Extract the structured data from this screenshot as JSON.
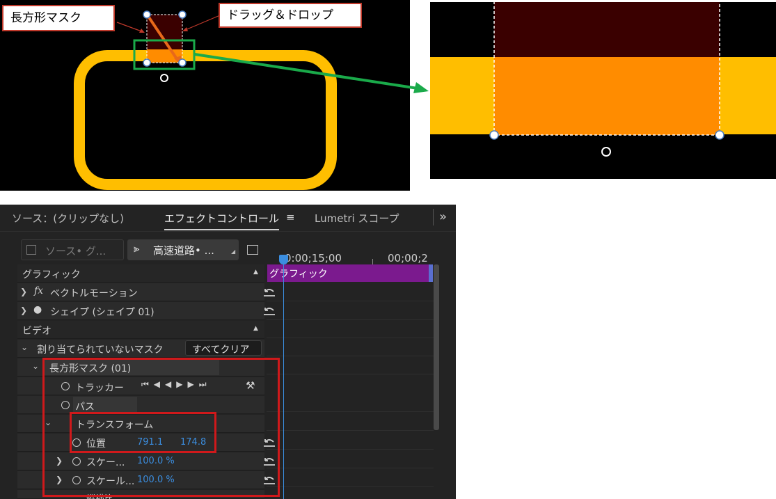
{
  "callouts": {
    "rect_mask": "長方形マスク",
    "drag_drop": "ドラッグ＆ドロップ"
  },
  "panel": {
    "tabs": {
      "source": "ソース：(クリップなし)",
      "effect_controls": "エフェクトコントロール",
      "lumetri": "Lumetri スコープ",
      "overflow": "»"
    },
    "source_dropdown": "ソース• グ...",
    "sequence_dropdown": "高速道路• ...",
    "timeline": {
      "time_a": "0:00;15;00",
      "time_b": "00;00;2",
      "clip_label": "グラフィック"
    },
    "sections": {
      "graphic": "グラフィック",
      "video": "ビデオ"
    },
    "rows": {
      "vector_motion": "ベクトルモーション",
      "fx": "fx",
      "shape": "シェイプ (シェイプ 01)",
      "unassigned_masks": "割り当てられていないマスク",
      "clear_all": "すべてクリア",
      "rect_mask": "長方形マスク (01)",
      "tracker": "トラッカー",
      "path": "パス",
      "transform": "トランスフォーム",
      "position_label": "位置",
      "position_x": "791.1",
      "position_y": "174.8",
      "scale1_label": "スケー...",
      "scale1_value": "100.0 %",
      "scale2_label": "スケール...",
      "scale2_value": "100.0 %",
      "aspect_label": "縦横比"
    }
  },
  "colors": {
    "ring": "#FFBE00",
    "mask_fill": "#FF8C00",
    "mask_dark": "#3A0000",
    "highlight_red": "#D0191B",
    "arrow_green": "#1AAA4A",
    "clip_purple": "#7B1A8E",
    "accent_blue": "#3B8EE0"
  }
}
